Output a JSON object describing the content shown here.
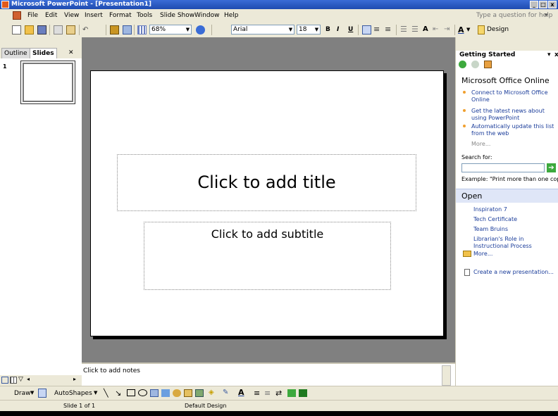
{
  "window": {
    "title": "Microsoft PowerPoint - [Presentation1]",
    "controls": [
      "_",
      "□",
      "x"
    ]
  },
  "menubar": {
    "items": [
      "File",
      "Edit",
      "View",
      "Insert",
      "Format",
      "Tools",
      "Slide Show",
      "Window",
      "Help"
    ],
    "question_placeholder": "Type a question for help"
  },
  "toolbar": {
    "zoom": "68%",
    "font": "Arial",
    "font_size": "18",
    "bold": "B",
    "italic": "I",
    "underline": "U",
    "design_label": "Design"
  },
  "left_pane": {
    "tabs": [
      "Outline",
      "Slides"
    ],
    "slide_number": "1"
  },
  "slide": {
    "title_placeholder": "Click to add title",
    "subtitle_placeholder": "Click to add subtitle"
  },
  "notes": {
    "placeholder": "Click to add notes"
  },
  "task_pane": {
    "header": "Getting Started",
    "office_online": {
      "heading": "Microsoft Office Online",
      "links": [
        "Connect to Microsoft Office Online",
        "Get the latest news about using PowerPoint",
        "Automatically update this list from the web"
      ],
      "more": "More..."
    },
    "search": {
      "label": "Search for:",
      "example": "Example: \"Print more than one copy\""
    },
    "open": {
      "heading": "Open",
      "files": [
        "Inspiraton 7",
        "Tech Certificate",
        "Team Bruins",
        "Librarian's Role in Instructional Process"
      ],
      "more": "More...",
      "create": "Create a new presentation..."
    }
  },
  "drawing_toolbar": {
    "draw": "Draw",
    "autoshapes": "AutoShapes"
  },
  "status_bar": {
    "slide": "Slide 1 of 1",
    "design": "Default Design"
  }
}
